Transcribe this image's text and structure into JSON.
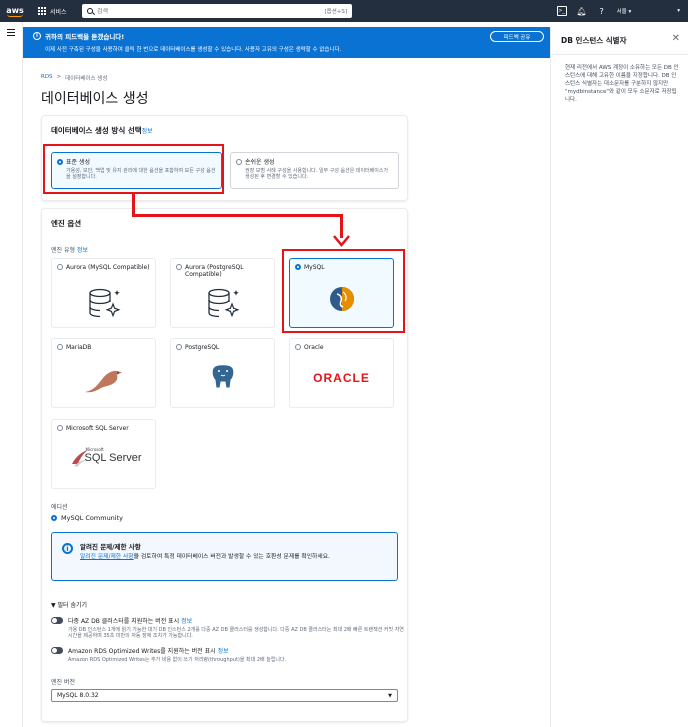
{
  "nav": {
    "logo": "aws",
    "services_label": "서비스",
    "search_placeholder": "검색",
    "search_shortcut": "[옵션+S]",
    "region_label": "서울 ▾",
    "account_label": "▾"
  },
  "banner": {
    "title": "귀하의 피드백을 듣겠습니다!",
    "message": "이제 사전 구축된 구성을 사용하여 클릭 한 번으로 데이터베이스를 생성할 수 있습니다. 사용자 고유의 구성은 생략할 수 없습니다.",
    "feedback_button": "피드백 공유",
    "close": "✕"
  },
  "breadcrumb": {
    "root": "RDS",
    "sep": ">",
    "current": "데이터베이스 생성"
  },
  "page_title": "데이터베이스 생성",
  "method": {
    "heading": "데이터베이스 생성 방식 선택",
    "info": "정보",
    "standard": {
      "title": "표준 생성",
      "desc": "가용성, 보안, 백업 및 유지 관리에 대한 옵션을 포함하여 모든 구성 옵션을 설정합니다."
    },
    "easy": {
      "title": "손쉬운 생성",
      "desc": "권장 모범 사례 구성을 사용합니다. 일부 구성 옵션은 데이터베이스가 생성된 후 변경할 수 있습니다."
    }
  },
  "engine": {
    "heading": "엔진 옵션",
    "type_label": "엔진 유형",
    "info": "정보",
    "cards": {
      "aurora_mysql": "Aurora (MySQL Compatible)",
      "aurora_pg": "Aurora (PostgreSQL Compatible)",
      "mysql": "MySQL",
      "mariadb": "MariaDB",
      "postgres": "PostgreSQL",
      "oracle": "Oracle",
      "sqlserver": "Microsoft SQL Server"
    },
    "oracle_logo_text": "ORACLE",
    "sqlserver_logo_small": "Microsoft",
    "sqlserver_logo_text": "SQL Server",
    "edition_label": "에디션",
    "edition_value": "MySQL Community",
    "notice_title": "알려진 문제/제한 사항",
    "notice_link": "알려진 문제/제한 사항",
    "notice_body": "을 검토하여 특정 데이터베이스 버전과 발생할 수 있는 호환성 문제를 확인하세요.",
    "filter_label": "▼ 필터 숨기기",
    "toggle1_title": "다중 AZ DB 클러스터를 지원하는 버전 표시",
    "toggle1_info": "정보",
    "toggle1_desc": "가용 DB 인스턴스 1개에 읽기 가능한 대기 DB 인스턴스 2개를 다중 AZ DB 클러스터를 생성합니다. 다중 AZ DB 클러스터는 최대 2배 빠른 트랜잭션 커밋 지연 시간을 제공하며 35초 미만의 자동 장애 조치가 가능합니다.",
    "toggle2_title": "Amazon RDS Optimized Writes를 지원하는 버전 표시",
    "toggle2_info": "정보",
    "toggle2_desc": "Amazon RDS Optimized Writes는 추가 비용 없이 쓰기 처리량(throughput)을 최대 2배 늘립니다.",
    "version_label": "엔진 버전",
    "version_value": "MySQL 8.0.32",
    "version_caret": "▼"
  },
  "help": {
    "title": "DB 인스턴스 식별자",
    "close": "✕",
    "body": "현재 리전에서 AWS 계정이 소유하는 모든 DB 인스턴스에 대해 고유한 이름을 지정합니다. DB 인스턴스 식별자는 대소문자를 구분하지 않지만 \"mydbinstance\"와 같이 모두 소문자로 저장됩니다."
  },
  "colors": {
    "accent": "#0972d3",
    "highlight": "#e5141a",
    "nav_bg": "#232f3e"
  }
}
